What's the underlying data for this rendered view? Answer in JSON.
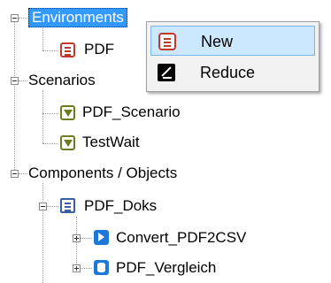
{
  "tree": {
    "environments": {
      "label": "Environments",
      "children": [
        {
          "label": "PDF"
        }
      ]
    },
    "scenarios": {
      "label": "Scenarios",
      "children": [
        {
          "label": "PDF_Scenario"
        },
        {
          "label": "TestWait"
        }
      ]
    },
    "components": {
      "label": "Components / Objects",
      "children": [
        {
          "label": "PDF_Doks",
          "children": [
            {
              "label": "Convert_PDF2CSV"
            },
            {
              "label": "PDF_Vergleich"
            }
          ]
        }
      ]
    }
  },
  "context_menu": {
    "items": [
      {
        "label": "New",
        "icon": "new-document-icon",
        "highlighted": true
      },
      {
        "label": "Reduce",
        "icon": "reduce-icon",
        "highlighted": false
      }
    ]
  },
  "colors": {
    "selection": "#3399ff",
    "menu_highlight": "#cce8ff",
    "document_icon": "#c0392b",
    "scenario_icon": "#6b7d1e",
    "component_icon": "#1e78d7"
  }
}
